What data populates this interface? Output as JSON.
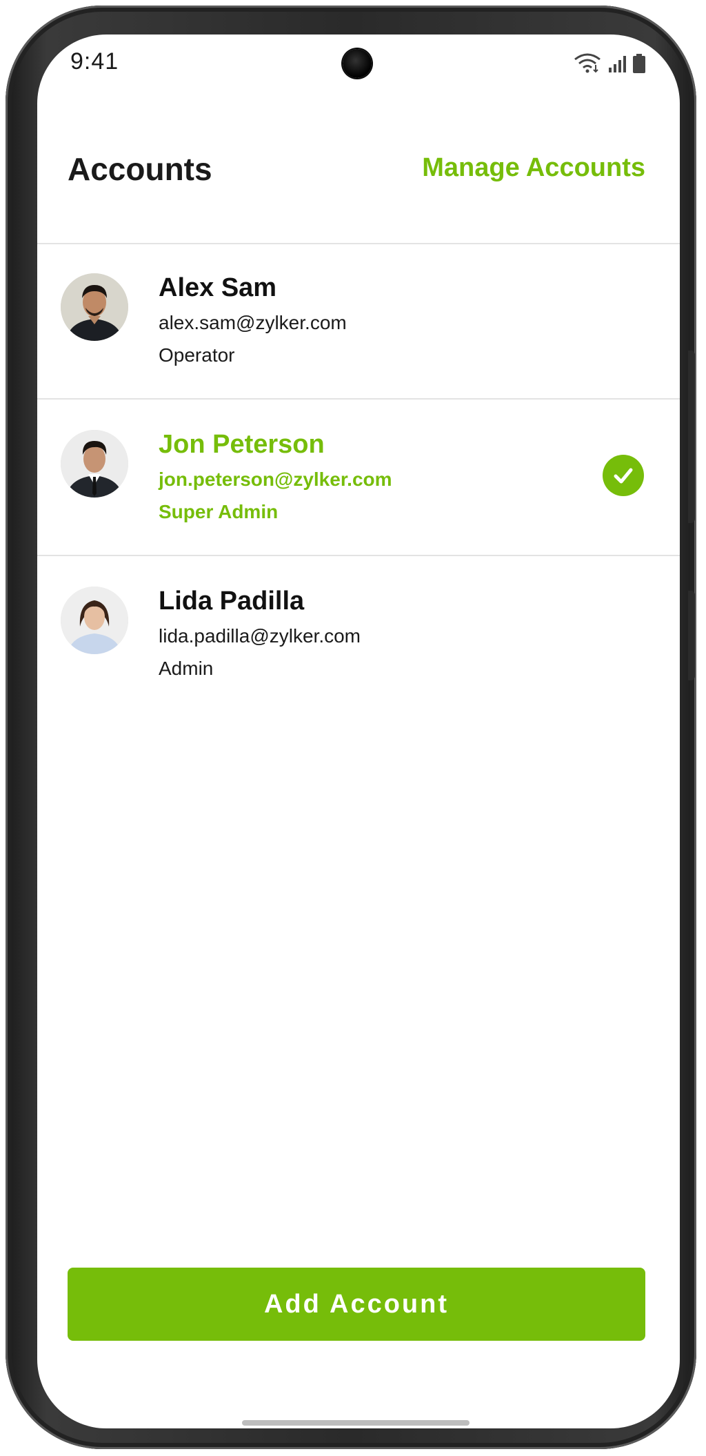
{
  "status_bar": {
    "time": "9:41",
    "icons": [
      "wifi-icon",
      "signal-icon",
      "battery-icon"
    ]
  },
  "header": {
    "title": "Accounts",
    "manage_label": "Manage Accounts"
  },
  "accounts": [
    {
      "name": "Alex Sam",
      "email": "alex.sam@zylker.com",
      "role": "Operator",
      "selected": false
    },
    {
      "name": "Jon Peterson",
      "email": "jon.peterson@zylker.com",
      "role": "Super Admin",
      "selected": true
    },
    {
      "name": "Lida Padilla",
      "email": "lida.padilla@zylker.com",
      "role": "Admin",
      "selected": false
    }
  ],
  "footer": {
    "add_label": "Add Account"
  },
  "colors": {
    "accent": "#76bd0a",
    "text": "#111111",
    "divider": "#e3e3e3"
  }
}
